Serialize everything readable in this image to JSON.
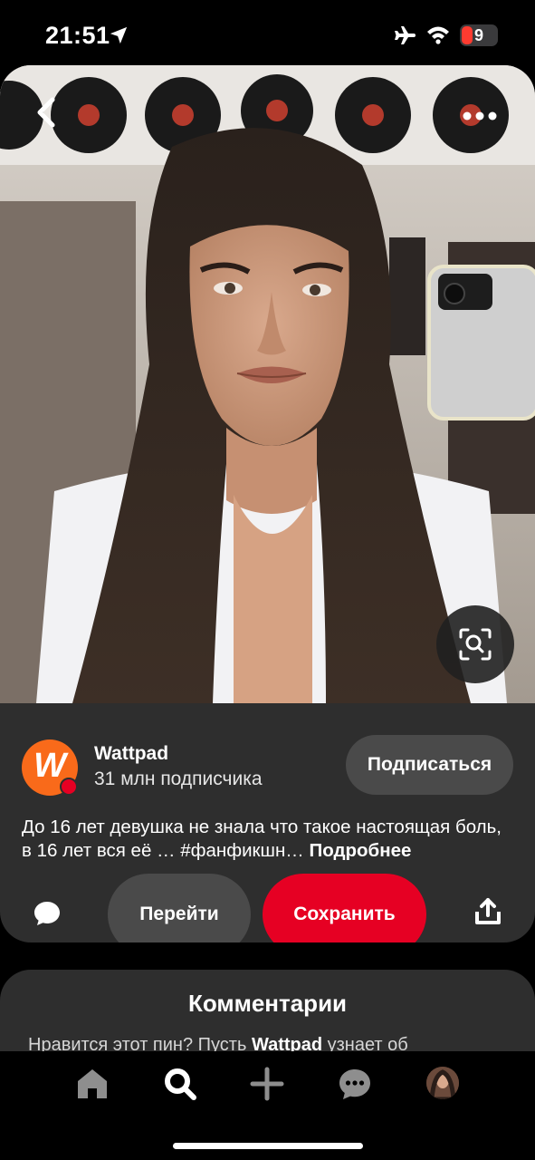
{
  "status_bar": {
    "time": "21:51",
    "battery": "9",
    "icons": [
      "location-arrow-icon",
      "airplane-icon",
      "wifi-icon",
      "battery-icon"
    ]
  },
  "pin": {
    "image_alt": "photo",
    "creator": {
      "name": "Wattpad",
      "followers": "31 млн подписчика",
      "avatar_letter": "W"
    },
    "follow_label": "Подписаться",
    "description": "До 16 лет девушка не знала что такое настоящая боль, в 16 лет вся её … #фанфикшн…",
    "more_label": "Подробнее",
    "visit_label": "Перейти",
    "save_label": "Сохранить"
  },
  "comments": {
    "title": "Комментарии",
    "prompt_before": "Нравится этот пин? Пусть ",
    "prompt_name": "Wattpad",
    "prompt_after": " узнает об"
  },
  "colors": {
    "accent": "#e60023",
    "brand_orange": "#f96a1a",
    "card_bg": "#2e2e2e",
    "button_bg": "#4a4a4a"
  },
  "bottom_nav": [
    "home-icon",
    "search-icon",
    "plus-icon",
    "messages-icon",
    "profile-avatar"
  ]
}
